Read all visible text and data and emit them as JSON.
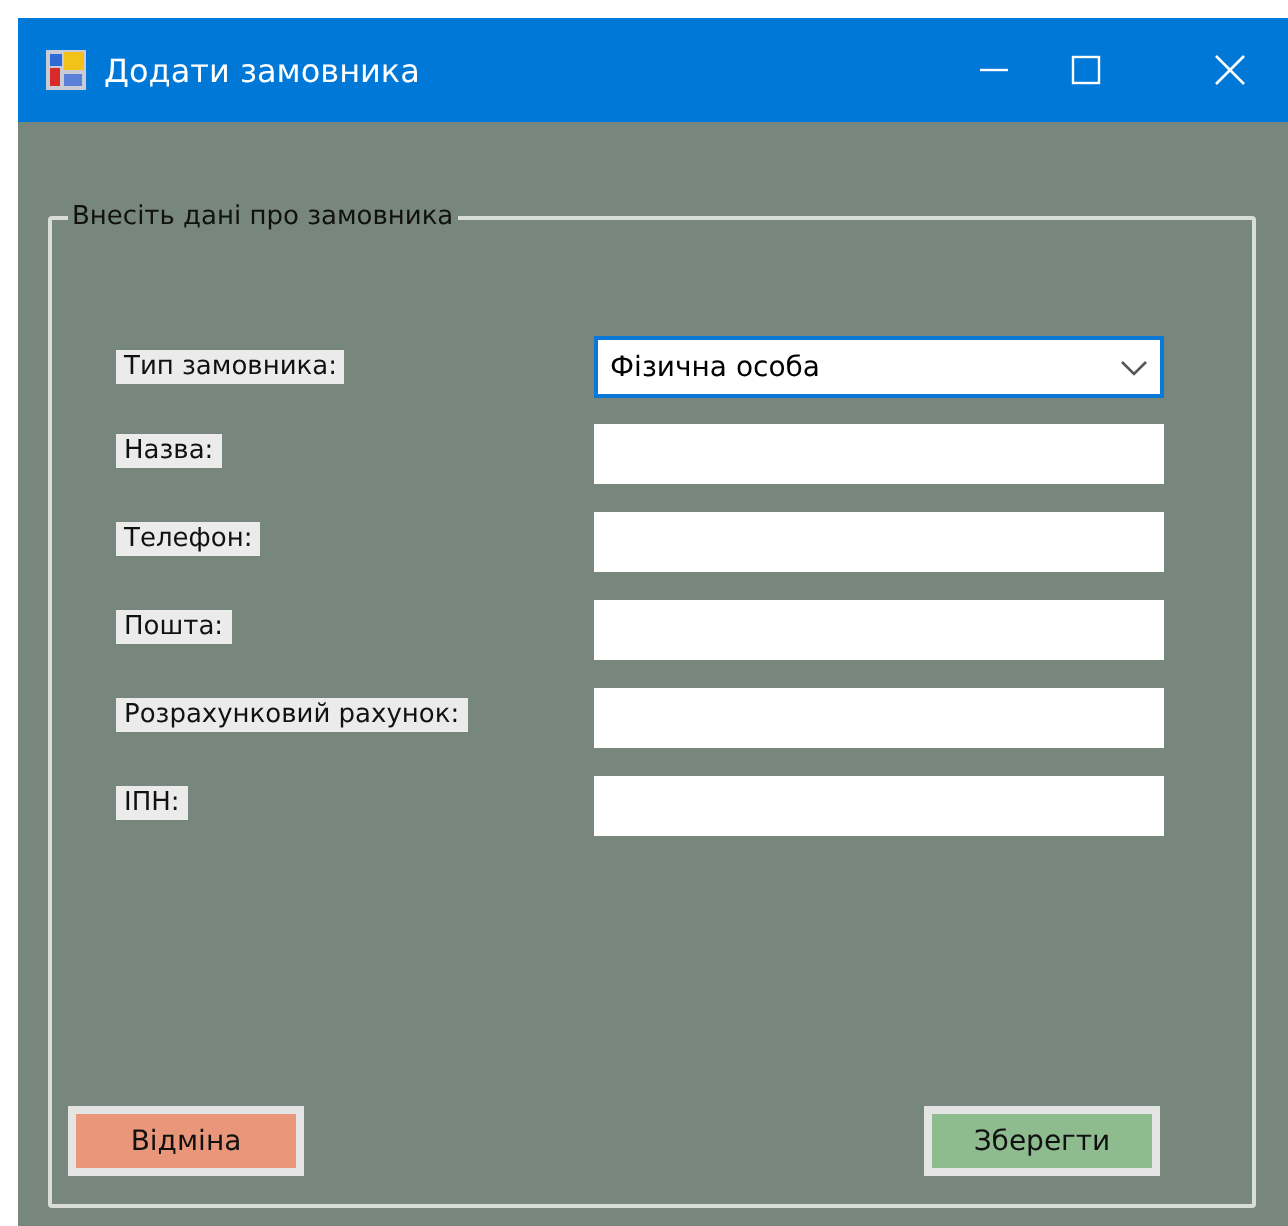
{
  "window": {
    "title": "Додати замовника"
  },
  "group": {
    "title": "Внесіть дані про замовника"
  },
  "fields": [
    {
      "label": "Тип замовника:",
      "kind": "combo",
      "value": "Фізична особа",
      "focused": true
    },
    {
      "label": "Назва:",
      "kind": "text",
      "focused": false
    },
    {
      "label": "Телефон:",
      "kind": "text",
      "focused": false
    },
    {
      "label": "Пошта:",
      "kind": "text",
      "focused": false
    },
    {
      "label": "Розрахунковий рахунок:",
      "kind": "text",
      "focused": false
    },
    {
      "label": "ІПН:",
      "kind": "text",
      "focused": false
    }
  ],
  "buttons": [
    {
      "label": "Відміна",
      "color": "#e9967a"
    },
    {
      "label": "Зберегти",
      "color": "#8fbc8f"
    }
  ]
}
